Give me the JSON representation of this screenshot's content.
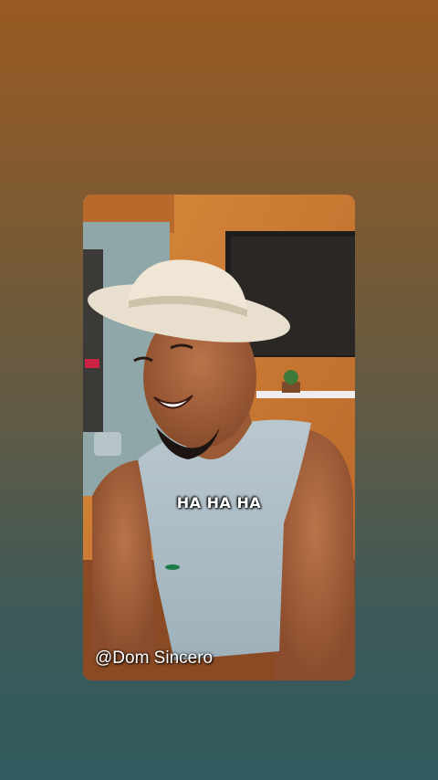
{
  "video": {
    "caption": "HA HA HA",
    "creator_handle": "@Dom Sincero"
  },
  "colors": {
    "background_top": "#9a5a22",
    "background_bottom": "#2f5a5e",
    "wall_orange": "#c97a2e"
  }
}
